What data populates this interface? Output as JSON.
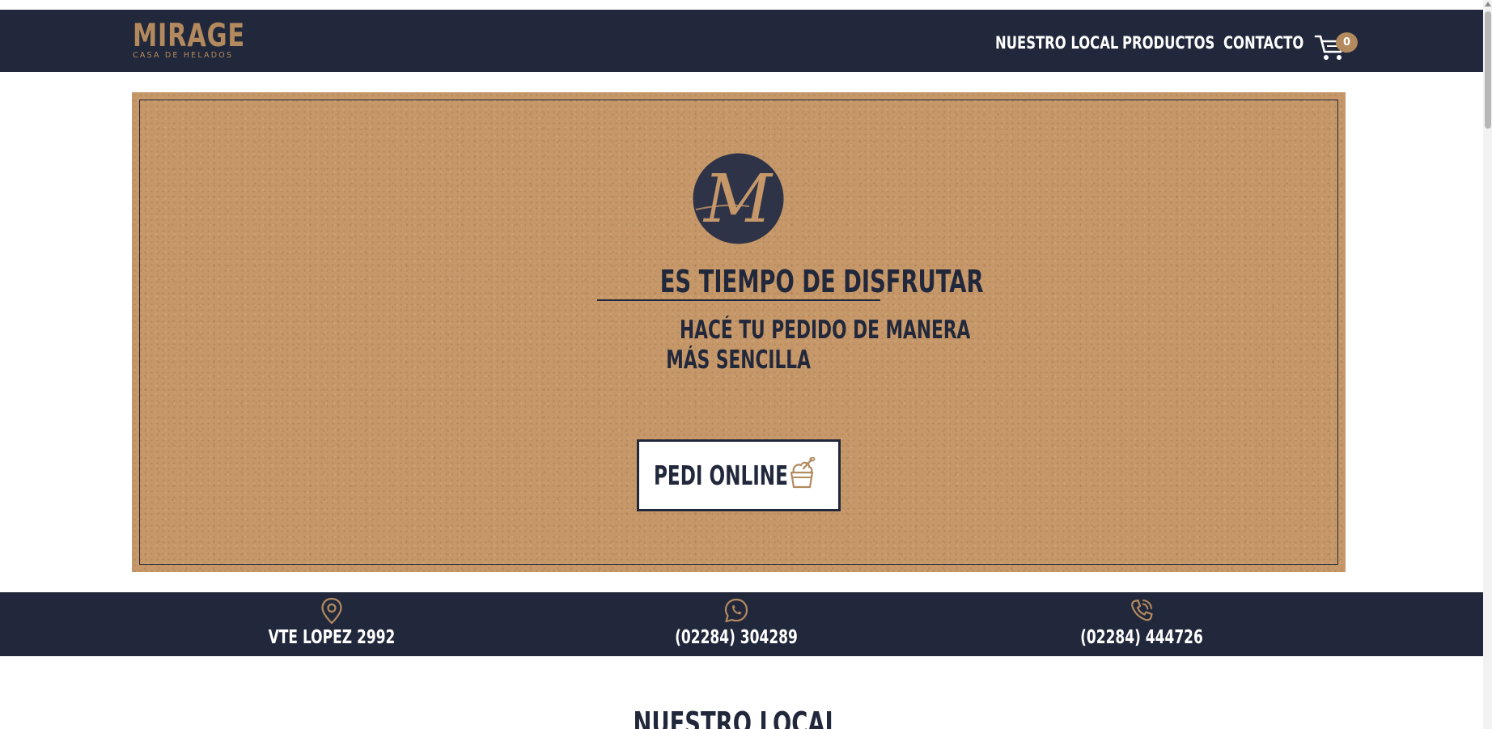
{
  "brand": {
    "name": "MIRAGE",
    "tagline": "CASA DE HELADOS",
    "emblem_letter": "M"
  },
  "nav": {
    "items": [
      {
        "label": "NUESTRO LOCAL"
      },
      {
        "label": "PRODUCTOS"
      },
      {
        "label": "CONTACTO"
      }
    ],
    "cart_count": "0"
  },
  "hero": {
    "title": "ES TIEMPO DE DISFRUTAR",
    "subtitle_line1": "HACÉ TU PEDIDO DE MANERA",
    "subtitle_line2": "MÁS SENCILLA",
    "button_label": "PEDI ONLINE"
  },
  "contact": {
    "address": "VTE LOPEZ 2992",
    "whatsapp": "(02284) 304289",
    "phone": "(02284) 444726"
  },
  "section": {
    "heading": "NUESTRO LOCAL"
  },
  "colors": {
    "navy": "#22283b",
    "gold": "#b38a5e",
    "kraft": "#c59769",
    "white": "#ffffff"
  },
  "icons": {
    "cart": "cart-icon",
    "location": "location-pin-icon",
    "whatsapp": "whatsapp-icon",
    "phone": "phone-icon",
    "ice_cream": "ice-cream-cup-icon"
  }
}
